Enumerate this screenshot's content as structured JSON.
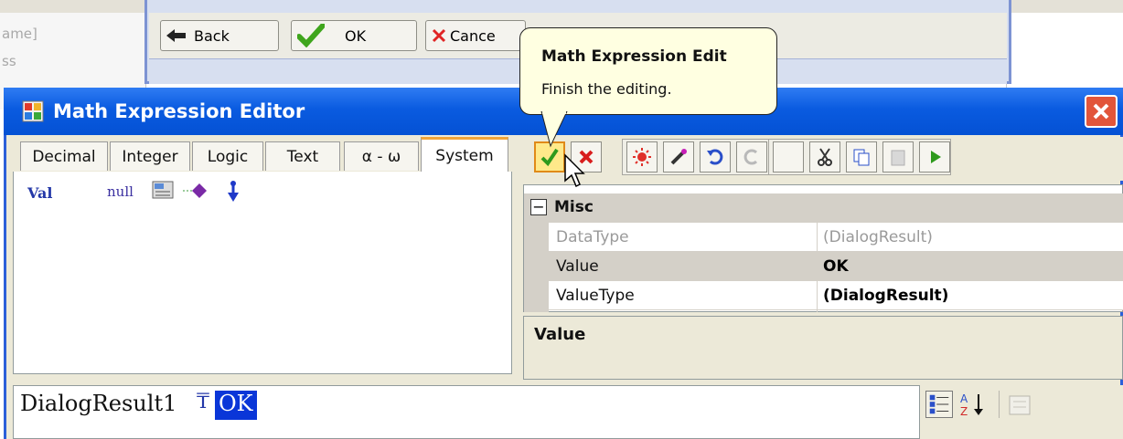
{
  "background": {
    "left_texts": [
      "ame]",
      "ss"
    ]
  },
  "behind_dialog": {
    "buttons": [
      {
        "label": "Back",
        "icon": "back-arrow-icon"
      },
      {
        "label": "OK",
        "icon": "green-check-icon"
      },
      {
        "label": "Cance",
        "icon": "red-x-icon"
      }
    ]
  },
  "tooltip": {
    "title": "Math Expression Edit",
    "body": "Finish the editing."
  },
  "window": {
    "title": "Math Expression Editor",
    "close_icon": "close-icon",
    "title_bar_color": "#0a5be0"
  },
  "tabs": [
    "Decimal",
    "Integer",
    "Logic",
    "Text",
    "α - ω",
    "System"
  ],
  "active_tab": "System",
  "system_tab": {
    "val_label": "Val",
    "null_label": "null"
  },
  "toolbar": {
    "icons": [
      "ok-check-icon",
      "cancel-x-icon",
      "sun-icon",
      "wand-icon",
      "undo-icon",
      "redo-icon",
      "cut-icon",
      "copy-icon",
      "paste-icon",
      "run-icon"
    ]
  },
  "property_grid": {
    "category": "Misc",
    "rows": [
      {
        "name": "DataType",
        "value": "(DialogResult)"
      },
      {
        "name": "Value",
        "value": "OK"
      },
      {
        "name": "ValueType",
        "value": "(DialogResult)"
      }
    ],
    "description_title": "Value"
  },
  "expression": {
    "name": "DialogResult1",
    "operator": "₸",
    "value": "OK"
  },
  "bottom_toolbar": {
    "az_label": "A Z"
  },
  "colors": {
    "accent_blue": "#0a36d8",
    "tooltip_bg": "#ffffe1",
    "ok_highlight": "#ffe98a"
  }
}
